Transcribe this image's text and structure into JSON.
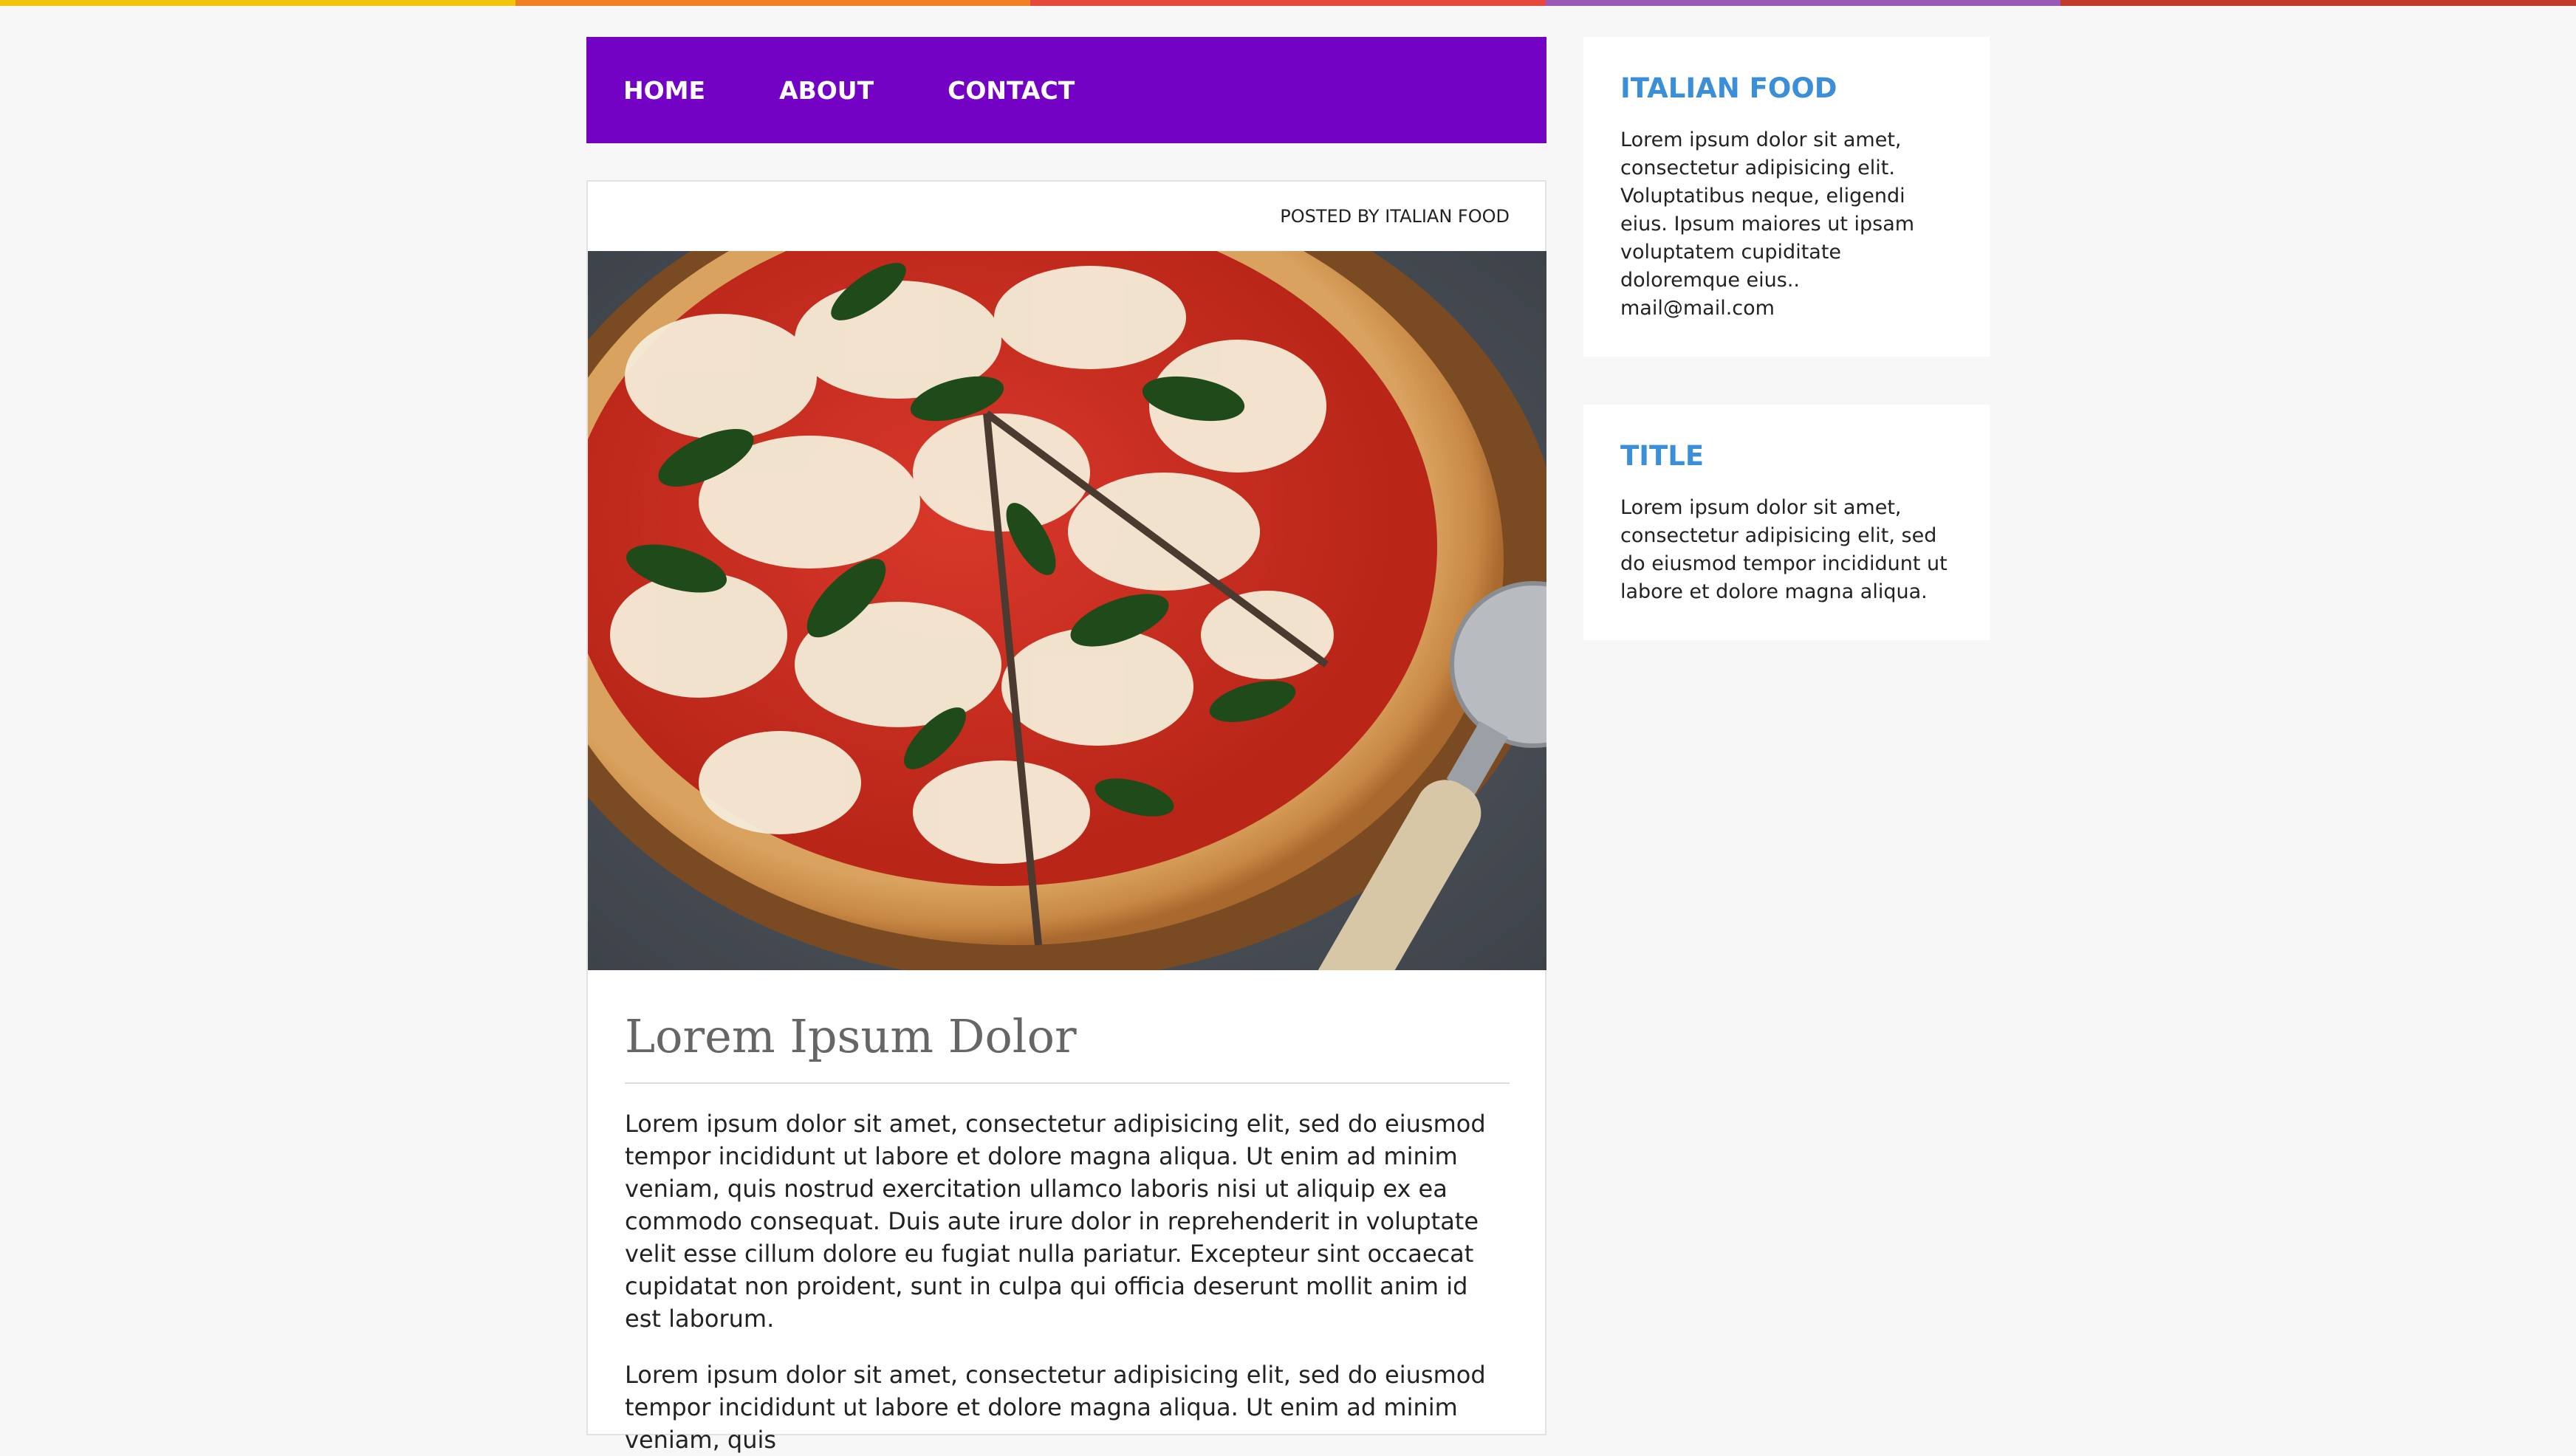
{
  "colors": {
    "accent_stripe": [
      "#f2c40c",
      "#ef7f22",
      "#e8473b",
      "#9b59b6",
      "#c0392b"
    ],
    "nav_bg": "#7302c4",
    "widget_title": "#3a8fd8"
  },
  "nav": {
    "items": [
      "HOME",
      "ABOUT",
      "CONTACT"
    ]
  },
  "post": {
    "meta": "POSTED BY ITALIAN FOOD",
    "image_icon": "pizza-photo",
    "title": "Lorem Ipsum Dolor",
    "paragraphs": [
      "Lorem ipsum dolor sit amet, consectetur adipisicing elit, sed do eiusmod tempor incididunt ut labore et dolore magna aliqua. Ut enim ad minim veniam, quis nostrud exercitation ullamco laboris nisi ut aliquip ex ea commodo consequat. Duis aute irure dolor in reprehenderit in voluptate velit esse cillum dolore eu fugiat nulla pariatur. Excepteur sint occaecat cupidatat non proident, sunt in culpa qui officia deserunt mollit anim id est laborum.",
      "Lorem ipsum dolor sit amet, consectetur adipisicing elit, sed do eiusmod tempor incididunt ut labore et dolore magna aliqua. Ut enim ad minim veniam, quis"
    ]
  },
  "sidebar": {
    "widgets": [
      {
        "title": "ITALIAN FOOD",
        "text": "Lorem ipsum dolor sit amet, consectetur adipisicing elit. Voluptatibus neque, eligendi eius. Ipsum maiores ut ipsam voluptatem cupiditate doloremque eius..",
        "email": "mail@mail.com"
      },
      {
        "title": "TITLE",
        "text": "Lorem ipsum dolor sit amet, consectetur adipisicing elit, sed do eiusmod tempor incididunt ut labore et dolore magna aliqua."
      }
    ]
  }
}
